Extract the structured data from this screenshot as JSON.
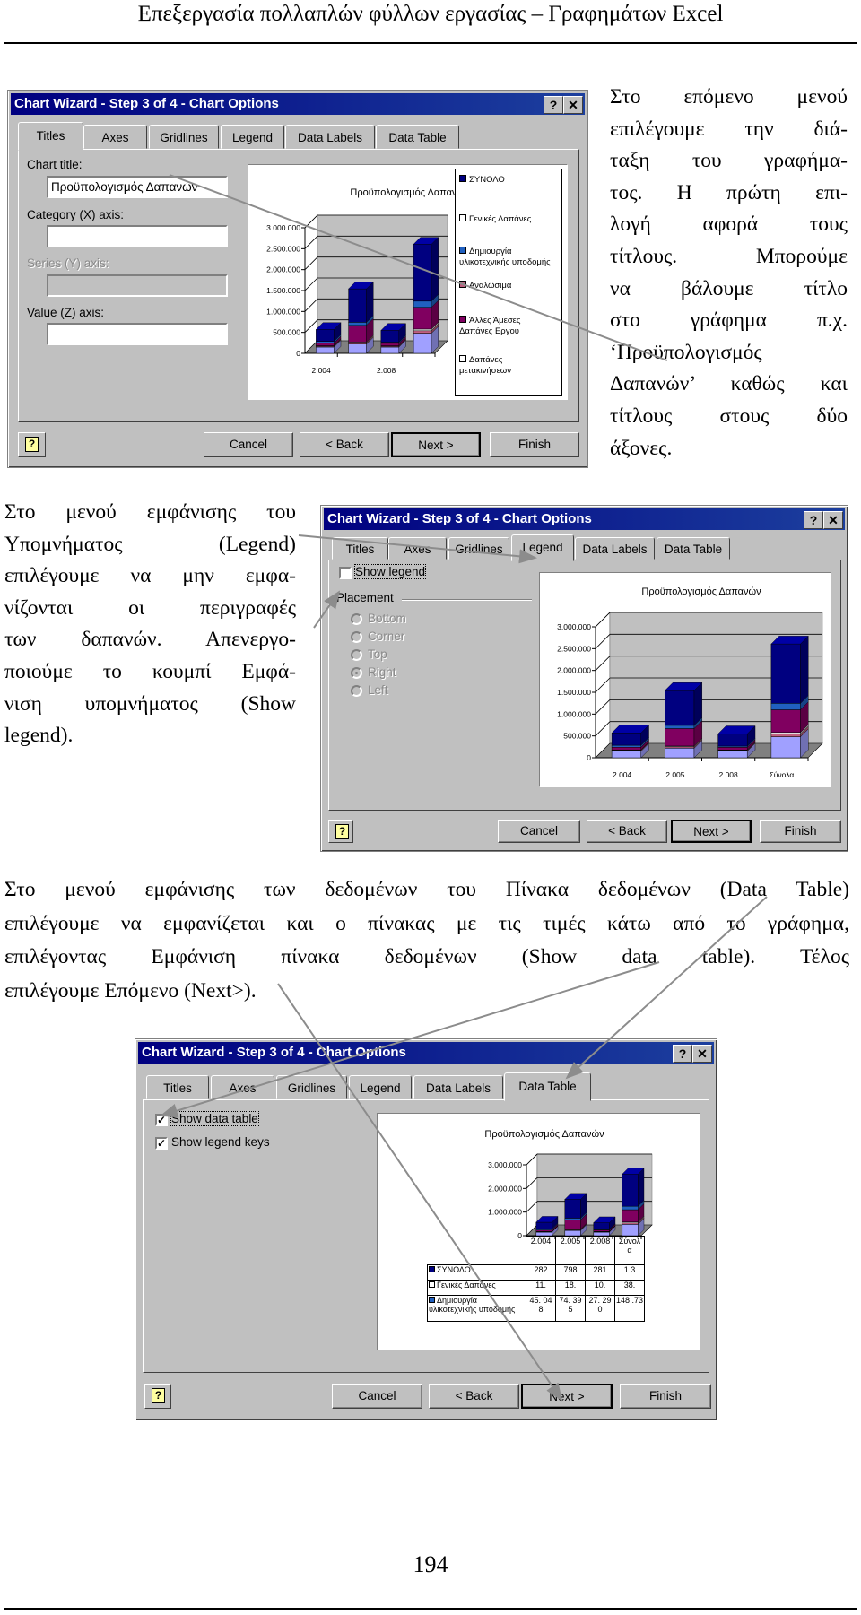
{
  "header": {
    "title": "Επεξεργασία πολλαπλών φύλλων εργασίας – Γραφημάτων Excel"
  },
  "page_number": "194",
  "text_right": {
    "lines": [
      "Στο επόμενο μενού",
      "επιλέγουμε την διά-",
      "ταξη του γραφήμα-",
      "τος. Η πρώτη επι-",
      "λογή αφορά τους",
      "τίτλους. Μπορούμε",
      "να βάλουμε τίτλο",
      "στο γράφημα π.χ.",
      "‘Προϋπολογισμός",
      "Δαπανών’ καθώς και",
      "τίτλους στους δύο",
      "άξονες."
    ]
  },
  "text_left": {
    "lines": [
      "Στο μενού εμφάνισης του",
      "Υπομνήματος (Legend)",
      "επιλέγουμε να μην εμφα-",
      "νίζονται οι περιγραφές",
      "των δαπανών. Απενεργο-",
      "ποιούμε το κουμπί Εμφά-",
      "νιση υπομνήματος (Show",
      "legend)."
    ]
  },
  "text_bottom": {
    "lines": [
      "Στο μενού εμφάνισης των δεδομένων του Πίνακα δεδομένων (Data Table)",
      "επιλέγουμε να εμφανίζεται και ο πίνακας με τις τιμές κάτω από το γράφημα,",
      "επιλέγοντας Εμφάνιση πίνακα δεδομένων (Show data table). Τέλος",
      "επιλέγουμε Επόμενο (Next>)."
    ]
  },
  "colors": {
    "titlebar": "#000080",
    "dialog": "#c0c0c0",
    "arrow": "#8c8c8c"
  },
  "chart_series": [
    {
      "name": "Δαπάνες μετακινήσεων",
      "color": "#a0a0ff"
    },
    {
      "name": "Αναλώσιμα",
      "color": "#c06080"
    },
    {
      "name": "Γενικές Δαπάνες",
      "color": "#ffffff"
    },
    {
      "name": "Άλλες Άμεσες Δαπάνες Εργου",
      "color": "#800060"
    },
    {
      "name": "Δημιουργία υλικοτεχνικής υποδομής",
      "color": "#2060c0"
    },
    {
      "name": "ΣΥΝΟΛΟ",
      "color": "#000080"
    }
  ],
  "chart_values": {
    "categories": [
      "2.004",
      "2.005",
      "2.008",
      "Σύνολα"
    ],
    "stacks": [
      [
        150000,
        20000,
        11000,
        60000,
        45000,
        282000
      ],
      [
        220000,
        30000,
        18000,
        400000,
        74000,
        798000
      ],
      [
        150000,
        20000,
        10000,
        60000,
        27000,
        281000
      ],
      [
        480000,
        60000,
        39000,
        520000,
        148000,
        1360000
      ]
    ]
  },
  "dialogs": [
    {
      "title": "Chart Wizard - Step 3 of 4 - Chart Options",
      "help_btn": "?",
      "close_btn": "✕",
      "tabs": [
        "Titles",
        "Axes",
        "Gridlines",
        "Legend",
        "Data Labels",
        "Data Table"
      ],
      "active_tab": 0,
      "buttons": [
        "Cancel",
        "< Back",
        "Next >",
        "Finish"
      ],
      "fields": [
        {
          "label": "Chart title:",
          "value": "Προϋπολογισμός Δαπανών",
          "disabled": false
        },
        {
          "label": "Category (X) axis:",
          "value": "",
          "disabled": false
        },
        {
          "label": "Series (Y) axis:",
          "value": "",
          "disabled": true
        },
        {
          "label": "Value (Z) axis:",
          "value": "",
          "disabled": false
        }
      ],
      "preview": {
        "title": "Προϋπολογισμός Δαπανών",
        "ticks": [
          "0",
          "500.000",
          "1.000.000",
          "1.500.000",
          "2.000.000",
          "2.500.000",
          "3.000.000"
        ],
        "ymax": 3000000,
        "category_labels": [
          "2.004",
          "",
          "2.008",
          ""
        ],
        "legend": [
          {
            "label": "ΣΥΝΟΛΟ",
            "color": "#000080"
          },
          {
            "label": "Γενικές Δαπάνες",
            "color": "#ffffff"
          },
          {
            "label": "Δημιουργία υλικοτεχνικής υποδομής",
            "color": "#2060c0"
          },
          {
            "label": "Αναλώσιμα",
            "color": "#c06080"
          },
          {
            "label": "Άλλες Άμεσες Δαπάνες Εργου",
            "color": "#800060"
          },
          {
            "label": "Δαπάνες μετακινήσεων",
            "color": "#ffffff"
          }
        ]
      }
    },
    {
      "title": "Chart Wizard - Step 3 of 4 - Chart Options",
      "help_btn": "?",
      "close_btn": "✕",
      "tabs": [
        "Titles",
        "Axes",
        "Gridlines",
        "Legend",
        "Data Labels",
        "Data Table"
      ],
      "active_tab": 3,
      "buttons": [
        "Cancel",
        "< Back",
        "Next >",
        "Finish"
      ],
      "show_legend": {
        "label": "Show legend",
        "checked": false
      },
      "placement": {
        "label": "Placement",
        "options": [
          "Bottom",
          "Corner",
          "Top",
          "Right",
          "Left"
        ],
        "selected": "Right",
        "disabled": true
      },
      "preview": {
        "title": "Προϋπολογισμός Δαπανών",
        "ticks": [
          "0",
          "500.000",
          "1.000.000",
          "1.500.000",
          "2.000.000",
          "2.500.000",
          "3.000.000"
        ],
        "ymax": 3000000,
        "category_labels": [
          "2.004",
          "2.005",
          "2.008",
          "Σύνολα"
        ]
      }
    },
    {
      "title": "Chart Wizard - Step 3 of 4 - Chart Options",
      "help_btn": "?",
      "close_btn": "✕",
      "tabs": [
        "Titles",
        "Axes",
        "Gridlines",
        "Legend",
        "Data Labels",
        "Data Table"
      ],
      "active_tab": 5,
      "buttons": [
        "Cancel",
        "< Back",
        "Next >",
        "Finish"
      ],
      "checkboxes": [
        {
          "label": "Show data table",
          "checked": true
        },
        {
          "label": "Show legend keys",
          "checked": true
        }
      ],
      "preview": {
        "title": "Προϋπολογισμός Δαπανών",
        "ticks": [
          "0",
          "1.000.000",
          "2.000.000",
          "3.000.000"
        ],
        "ymax": 3000000,
        "category_labels": [
          "",
          "",
          "",
          ""
        ],
        "data_table": {
          "header": [
            "2.004",
            "2.005",
            "2.008",
            "Σύνολ α"
          ],
          "rows": [
            {
              "label": "ΣΥΝΟΛΟ",
              "color": "#000080",
              "cells": [
                "282",
                "798",
                "281",
                "1.3"
              ]
            },
            {
              "label": "Γενικές Δαπάνες",
              "color": "#ffffff",
              "cells": [
                "11.",
                "18.",
                "10.",
                "38."
              ]
            },
            {
              "label": "Δημιουργία υλικοτεχνικής υποδομής",
              "color": "#2060c0",
              "cells": [
                "45. 048",
                "74. 395",
                "27. 290",
                "148 .73"
              ]
            }
          ]
        }
      }
    }
  ]
}
